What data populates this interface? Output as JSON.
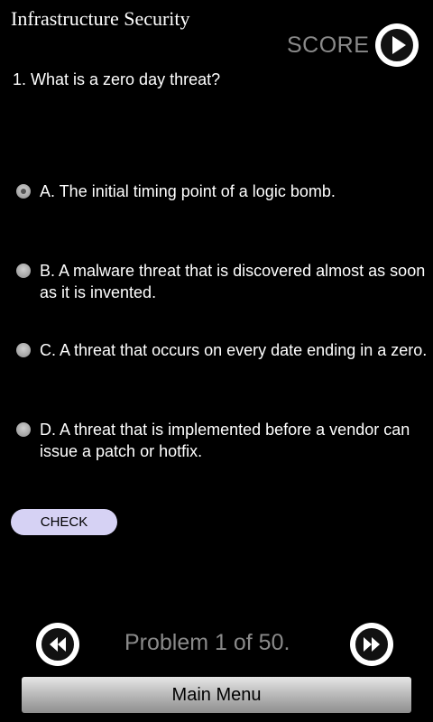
{
  "app": {
    "title": "Infrastructure Security"
  },
  "score": {
    "label": "SCORE"
  },
  "question": {
    "text": "1. What is a zero day threat?",
    "options": [
      {
        "label": "A. The initial timing point of a logic bomb.",
        "selected": true
      },
      {
        "label": " B. A malware threat that is discovered almost as soon as it is invented.",
        "selected": false
      },
      {
        "label": " C. A threat that occurs on every date ending in a zero.",
        "selected": false
      },
      {
        "label": " D. A threat that is implemented before a vendor can issue a patch or hotfix.",
        "selected": false
      }
    ]
  },
  "actions": {
    "check_label": "CHECK",
    "main_menu_label": "Main Menu"
  },
  "pagination": {
    "label": "Problem 1 of 50."
  },
  "icons": {
    "score": "play-icon",
    "prev": "rewind-icon",
    "next": "fast-forward-icon"
  },
  "colors": {
    "background": "#000000",
    "check_button": "#d6d2f4",
    "muted_text": "#8a8a8a"
  }
}
